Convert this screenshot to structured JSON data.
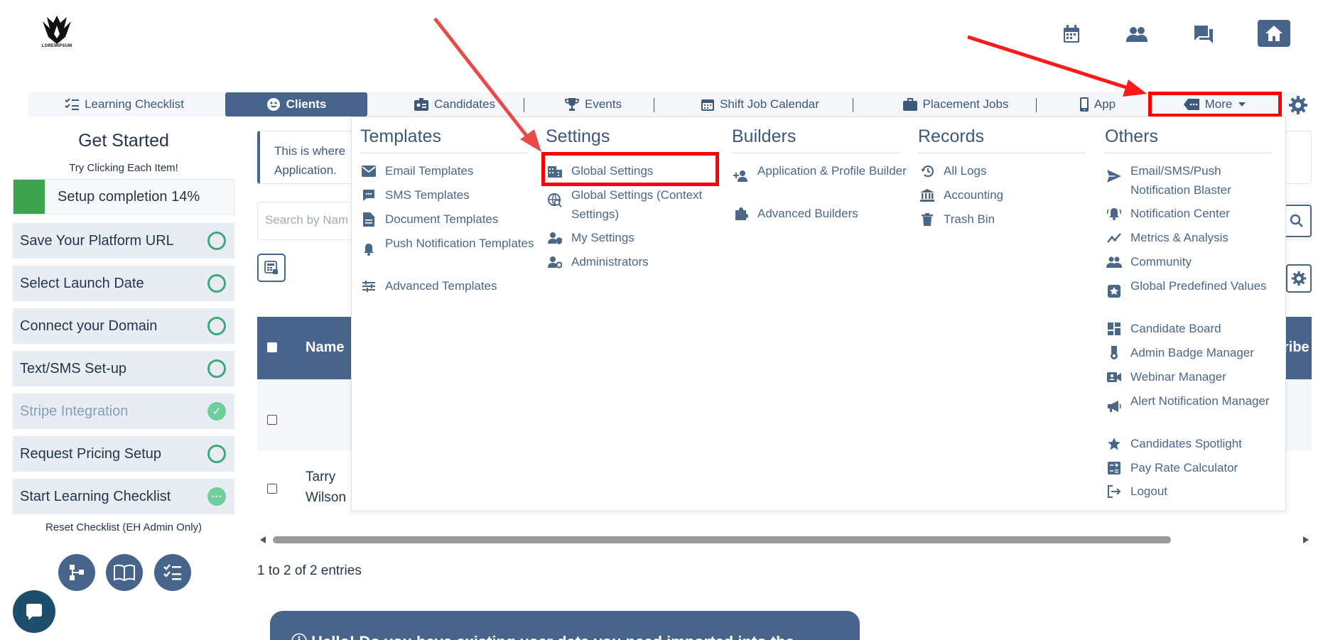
{
  "logo": {
    "brand_text": "LOREMIPSUM"
  },
  "top_icons": [
    "calendar-icon",
    "people-icon",
    "chat-icon",
    "home-icon"
  ],
  "nav": {
    "items": [
      {
        "label": "Learning Checklist",
        "icon": "checklist-icon",
        "active": false
      },
      {
        "label": "Clients",
        "icon": "smiley-icon",
        "active": true
      },
      {
        "label": "Candidates",
        "icon": "id-card-icon",
        "active": false
      },
      {
        "label": "Events",
        "icon": "trophy-icon",
        "active": false
      },
      {
        "label": "Shift Job Calendar",
        "icon": "calendar-icon",
        "active": false
      },
      {
        "label": "Placement Jobs",
        "icon": "briefcase-icon",
        "active": false
      },
      {
        "label": "App",
        "icon": "phone-icon",
        "active": false
      },
      {
        "label": "More",
        "icon": "tag-icon",
        "active": false
      }
    ]
  },
  "sidebar": {
    "title": "Get Started",
    "subtitle": "Try Clicking Each Item!",
    "progress_label": "Setup completion 14%",
    "progress": 0.14,
    "items": [
      {
        "label": "Save Your Platform URL",
        "status": "pending"
      },
      {
        "label": "Select Launch Date",
        "status": "pending"
      },
      {
        "label": "Connect your Domain",
        "status": "pending"
      },
      {
        "label": "Text/SMS Set-up",
        "status": "pending"
      },
      {
        "label": "Stripe Integration",
        "status": "done"
      },
      {
        "label": "Request Pricing Setup",
        "status": "pending"
      },
      {
        "label": "Start Learning Checklist",
        "status": "in-progress"
      }
    ],
    "reset_label": "Reset Checklist (EH Admin Only)"
  },
  "main": {
    "info_line1": "This is where",
    "info_line2": "Application.",
    "search_placeholder": "Search by Nam",
    "table": {
      "col_name": "Name",
      "col_tail": "ribe",
      "row2_name_line1": "Tarry",
      "row2_name_line2": "Wilson"
    },
    "entries": "1 to 2 of 2 entries",
    "hello": "Hello! Do you have existing user data you need imported into the"
  },
  "menu": {
    "templates": {
      "title": "Templates",
      "items": [
        {
          "label": "Email Templates",
          "icon": "envelope-icon"
        },
        {
          "label": "SMS Templates",
          "icon": "sms-icon"
        },
        {
          "label": "Document Templates",
          "icon": "document-icon"
        },
        {
          "label": "Push Notification Templates",
          "icon": "bell-icon"
        },
        {
          "label": "Advanced Templates",
          "icon": "sliders-icon"
        }
      ]
    },
    "settings": {
      "title": "Settings",
      "items": [
        {
          "label": "Global Settings",
          "icon": "building-icon"
        },
        {
          "label": "Global Settings (Context Settings)",
          "icon": "globe-search-icon"
        },
        {
          "label": "My Settings",
          "icon": "user-shield-icon"
        },
        {
          "label": "Administrators",
          "icon": "user-gear-icon"
        }
      ]
    },
    "builders": {
      "title": "Builders",
      "items": [
        {
          "label": "Application & Profile Builder",
          "icon": "user-plus-icon"
        },
        {
          "label": "Advanced Builders",
          "icon": "puzzle-icon"
        }
      ]
    },
    "records": {
      "title": "Records",
      "items": [
        {
          "label": "All Logs",
          "icon": "history-icon"
        },
        {
          "label": "Accounting",
          "icon": "bank-icon"
        },
        {
          "label": "Trash Bin",
          "icon": "trash-icon"
        }
      ]
    },
    "others": {
      "title": "Others",
      "items": [
        {
          "label": "Email/SMS/Push Notification Blaster",
          "icon": "send-icon"
        },
        {
          "label": "Notification Center",
          "icon": "bell-ring-icon"
        },
        {
          "label": "Metrics & Analysis",
          "icon": "chart-line-icon"
        },
        {
          "label": "Community",
          "icon": "people-icon"
        },
        {
          "label": "Global Predefined Values",
          "icon": "box-icon"
        },
        {
          "label": "Candidate Board",
          "icon": "dashboard-icon"
        },
        {
          "label": "Admin Badge Manager",
          "icon": "badge-icon"
        },
        {
          "label": "Webinar Manager",
          "icon": "video-icon"
        },
        {
          "label": "Alert Notification Manager",
          "icon": "megaphone-icon"
        },
        {
          "label": "Candidates Spotlight",
          "icon": "star-icon"
        },
        {
          "label": "Pay Rate Calculator",
          "icon": "calculator-icon"
        },
        {
          "label": "Logout",
          "icon": "logout-icon"
        }
      ]
    }
  },
  "colors": {
    "primary": "#47648a",
    "highlight": "#ff0000",
    "success": "#3fa34d"
  }
}
